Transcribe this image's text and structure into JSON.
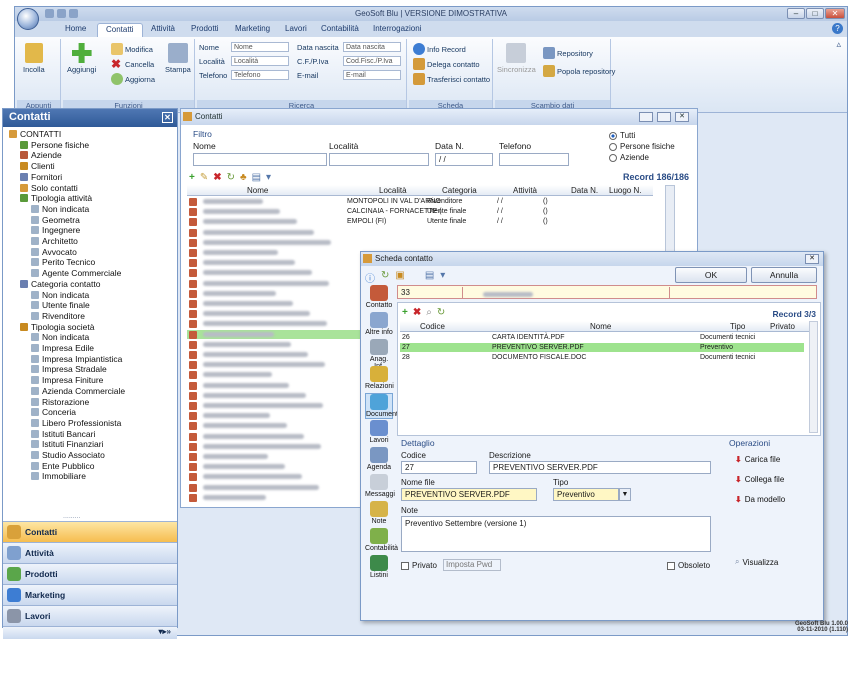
{
  "window": {
    "title": "GeoSoft Blu  |  VERSIONE DIMOSTRATIVA"
  },
  "tabs": [
    "Home",
    "Contatti",
    "Attività",
    "Prodotti",
    "Marketing",
    "Lavori",
    "Contabilità",
    "Interrogazioni"
  ],
  "ribbon": {
    "appunti": {
      "caption": "Appunti",
      "incolla": "Incolla"
    },
    "funzioni": {
      "caption": "Funzioni",
      "aggiungi": "Aggiungi",
      "modifica": "Modifica",
      "cancella": "Cancella",
      "aggiorna": "Aggiorna",
      "stampa": "Stampa"
    },
    "ricerca": {
      "caption": "Ricerca",
      "nome_lbl": "Nome",
      "nome_ph": "Nome",
      "localita_lbl": "Località",
      "localita_ph": "Località",
      "telefono_lbl": "Telefono",
      "telefono_ph": "Telefono",
      "datanascita_lbl": "Data nascita",
      "datanascita_ph": "Data nascita",
      "cf_lbl": "C.F./P.Iva",
      "cf_ph": "Cod.Fisc./P.Iva",
      "email_lbl": "E-mail",
      "email_ph": "E-mail"
    },
    "scheda": {
      "caption": "Scheda",
      "info": "Info Record",
      "delega": "Delega contatto",
      "trasferisci": "Trasferisci contatto"
    },
    "scambio": {
      "caption": "Scambio dati",
      "sincronizza": "Sincronizza",
      "repository": "Repository",
      "popola": "Popola repository"
    }
  },
  "sidebar": {
    "title": "Contatti",
    "tree": [
      {
        "label": "CONTATTI",
        "level": 0
      },
      {
        "label": "Persone fisiche",
        "level": 1
      },
      {
        "label": "Aziende",
        "level": 1
      },
      {
        "label": "Clienti",
        "level": 1
      },
      {
        "label": "Fornitori",
        "level": 1
      },
      {
        "label": "Solo contatti",
        "level": 1
      },
      {
        "label": "Tipologia attività",
        "level": 1
      },
      {
        "label": "Non indicata",
        "level": 2
      },
      {
        "label": "Geometra",
        "level": 2
      },
      {
        "label": "Ingegnere",
        "level": 2
      },
      {
        "label": "Architetto",
        "level": 2
      },
      {
        "label": "Avvocato",
        "level": 2
      },
      {
        "label": "Perito Tecnico",
        "level": 2
      },
      {
        "label": "Agente Commerciale",
        "level": 2
      },
      {
        "label": "Categoria contatto",
        "level": 1
      },
      {
        "label": "Non indicata",
        "level": 2
      },
      {
        "label": "Utente finale",
        "level": 2
      },
      {
        "label": "Rivenditore",
        "level": 2
      },
      {
        "label": "Tipologia società",
        "level": 1
      },
      {
        "label": "Non indicata",
        "level": 2
      },
      {
        "label": "Impresa Edile",
        "level": 2
      },
      {
        "label": "Impresa Impiantistica",
        "level": 2
      },
      {
        "label": "Impresa Stradale",
        "level": 2
      },
      {
        "label": "Impresa Finiture",
        "level": 2
      },
      {
        "label": "Azienda Commerciale",
        "level": 2
      },
      {
        "label": "Ristorazione",
        "level": 2
      },
      {
        "label": "Conceria",
        "level": 2
      },
      {
        "label": "Libero Professionista",
        "level": 2
      },
      {
        "label": "Istituti Bancari",
        "level": 2
      },
      {
        "label": "Istituti Finanziari",
        "level": 2
      },
      {
        "label": "Studio Associato",
        "level": 2
      },
      {
        "label": "Ente Pubblico",
        "level": 2
      },
      {
        "label": "Immobiliare",
        "level": 2
      }
    ],
    "nav": [
      "Contatti",
      "Attività",
      "Prodotti",
      "Marketing",
      "Lavori"
    ]
  },
  "contatti": {
    "title": "Contatti",
    "filtro": "Filtro",
    "nome_lbl": "Nome",
    "localita_lbl": "Località",
    "datan_lbl": "Data N.",
    "datan_val": "/ /",
    "telefono_lbl": "Telefono",
    "radios": [
      "Tutti",
      "Persone fisiche",
      "Aziende"
    ],
    "record": "Record 186/186",
    "columns": [
      "Nome",
      "Località",
      "Categoria",
      "Attività",
      "Data N.",
      "Luogo N."
    ],
    "rows": [
      {
        "localita": "MONTOPOLI IN VAL D'ARNO",
        "categoria": "Rivenditore",
        "datan": "/ /",
        "luogo": "()"
      },
      {
        "localita": "CALCINAIA - FORNACETTE (",
        "categoria": "Utente finale",
        "datan": "/ /",
        "luogo": "()"
      },
      {
        "localita": "EMPOLI (FI)",
        "categoria": "Utente finale",
        "datan": "/ /",
        "luogo": "()"
      }
    ]
  },
  "scheda": {
    "title": "Scheda contatto",
    "ok": "OK",
    "annulla": "Annulla",
    "code": "33",
    "record": "Record 3/3",
    "side": [
      "Contatto",
      "Altre info",
      "Anag. Inf.",
      "Relazioni",
      "Documenti",
      "Lavori",
      "Agenda",
      "Messaggi",
      "Note",
      "Contabilità",
      "Listini"
    ],
    "doc_columns": [
      "Codice",
      "Nome",
      "Tipo",
      "Privato"
    ],
    "docs": [
      {
        "codice": "26",
        "nome": "CARTA IDENTITÀ.PDF",
        "tipo": "Documenti tecnici"
      },
      {
        "codice": "27",
        "nome": "PREVENTIVO SERVER.PDF",
        "tipo": "Preventivo"
      },
      {
        "codice": "28",
        "nome": "DOCUMENTO FISCALE.DOC",
        "tipo": "Documenti tecnici"
      }
    ],
    "dettaglio": {
      "title": "Dettaglio",
      "codice_lbl": "Codice",
      "codice": "27",
      "descr_lbl": "Descrizione",
      "descr": "PREVENTIVO SERVER.PDF",
      "nomefile_lbl": "Nome file",
      "nomefile": "PREVENTIVO SERVER.PDF",
      "tipo_lbl": "Tipo",
      "tipo": "Preventivo",
      "note_lbl": "Note",
      "note": "Preventivo Settembre (versione 1)",
      "privato": "Privato",
      "imposta": "Imposta Pwd",
      "obsoleto": "Obsoleto"
    },
    "operazioni": {
      "title": "Operazioni",
      "carica": "Carica file",
      "collega": "Collega file",
      "modello": "Da modello",
      "visualizza": "Visualizza"
    }
  },
  "version": {
    "line1": "GeoSoft Blu 1.00.0",
    "line2": "03-11-2010 (1.110)"
  }
}
